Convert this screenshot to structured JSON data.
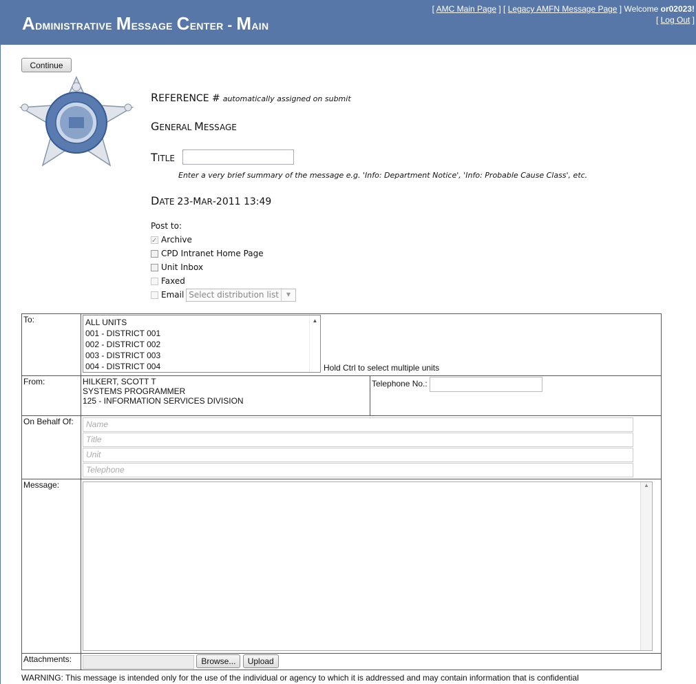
{
  "header": {
    "title_first_letter": "A",
    "title_rest": "dministrative ",
    "title_m": "M",
    "title_rest2": "essage ",
    "title_c": "C",
    "title_rest3": "enter - ",
    "title_main_m": "M",
    "title_main_rest": "ain",
    "amc_main_link": "AMC Main Page",
    "legacy_link": "Legacy AMFN Message Page",
    "welcome_text": "Welcome",
    "username": "or02023!",
    "logout_link": "Log Out"
  },
  "continue_label": "Continue",
  "reference": {
    "label_big": "R",
    "label_rest": "EFERENCE #",
    "note": "automatically assigned on submit"
  },
  "general_message": {
    "big": "G",
    "rest": "ENERAL ",
    "big2": "M",
    "rest2": "ESSAGE"
  },
  "title_field": {
    "big": "T",
    "rest": "ITLE",
    "value": "",
    "hint": "Enter a very brief summary of the message e.g. 'Info: Department Notice', 'Info: Probable Cause Class', etc."
  },
  "date": {
    "big": "D",
    "rest": "ATE",
    "value": "23-M",
    "value_rest": "AR",
    "value_tail": "-2011 13:49"
  },
  "post_to": {
    "label": "Post to:",
    "options": [
      {
        "label": "Archive",
        "checked": true,
        "disabled": true
      },
      {
        "label": "CPD Intranet Home Page",
        "checked": false,
        "disabled": false
      },
      {
        "label": "Unit Inbox",
        "checked": false,
        "disabled": false
      },
      {
        "label": "Faxed",
        "checked": false,
        "disabled": true
      },
      {
        "label": "Email",
        "checked": false,
        "disabled": true
      }
    ],
    "distribution_placeholder": "Select distribution list"
  },
  "form": {
    "to_label": "To:",
    "units": [
      "ALL UNITS",
      "001 - DISTRICT 001",
      "002 - DISTRICT 002",
      "003 - DISTRICT 003",
      "004 - DISTRICT 004"
    ],
    "units_hint": "Hold Ctrl to select multiple units",
    "from_label": "From:",
    "from_name": "HILKERT, SCOTT T",
    "from_title": "SYSTEMS PROGRAMMER",
    "from_unit": "125 - INFORMATION SERVICES DIVISION",
    "telephone_label": "Telephone No.:",
    "behalf_label": "On Behalf Of:",
    "behalf_placeholders": {
      "name": "Name",
      "title": "Title",
      "unit": "Unit",
      "telephone": "Telephone"
    },
    "message_label": "Message:",
    "attachments_label": "Attachments:",
    "browse_label": "Browse...",
    "upload_label": "Upload"
  },
  "warning": "WARNING: This message is intended only for the use of the individual or agency to which it is addressed and may contain information that is confidential"
}
